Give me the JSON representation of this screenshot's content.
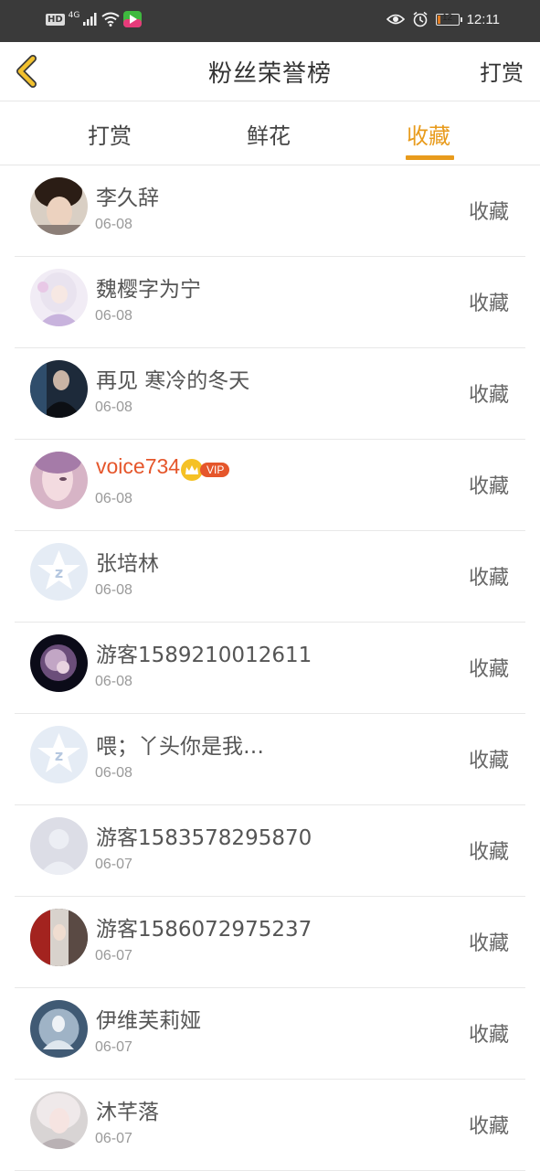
{
  "status_bar": {
    "hd": "HD",
    "network": "4G",
    "battery": "12",
    "time": "12:11"
  },
  "header": {
    "title": "粉丝荣誉榜",
    "right_action": "打赏"
  },
  "tabs": [
    {
      "label": "打赏",
      "active": false
    },
    {
      "label": "鲜花",
      "active": false
    },
    {
      "label": "收藏",
      "active": true
    }
  ],
  "list": [
    {
      "name": "李久辞",
      "date": "06-08",
      "action": "收藏"
    },
    {
      "name": "魏樱字为宁",
      "date": "06-08",
      "action": "收藏"
    },
    {
      "name": "再见 寒冷的冬天",
      "date": "06-08",
      "action": "收藏"
    },
    {
      "name": "voice734",
      "date": "06-08",
      "action": "收藏",
      "vip": "VIP"
    },
    {
      "name": "张培林",
      "date": "06-08",
      "action": "收藏"
    },
    {
      "name": "游客1589210012611",
      "date": "06-08",
      "action": "收藏"
    },
    {
      "name": "喂；丫头你是我…",
      "date": "06-08",
      "action": "收藏"
    },
    {
      "name": "游客1583578295870",
      "date": "06-07",
      "action": "收藏"
    },
    {
      "name": "游客1586072975237",
      "date": "06-07",
      "action": "收藏"
    },
    {
      "name": "伊维芙莉娅",
      "date": "06-07",
      "action": "收藏"
    },
    {
      "name": "沐芊落",
      "date": "06-07",
      "action": "收藏"
    }
  ],
  "colors": {
    "accent": "#e89b1c",
    "vip_name": "#e5562b",
    "status_bar_bg": "#3a3a3a"
  }
}
